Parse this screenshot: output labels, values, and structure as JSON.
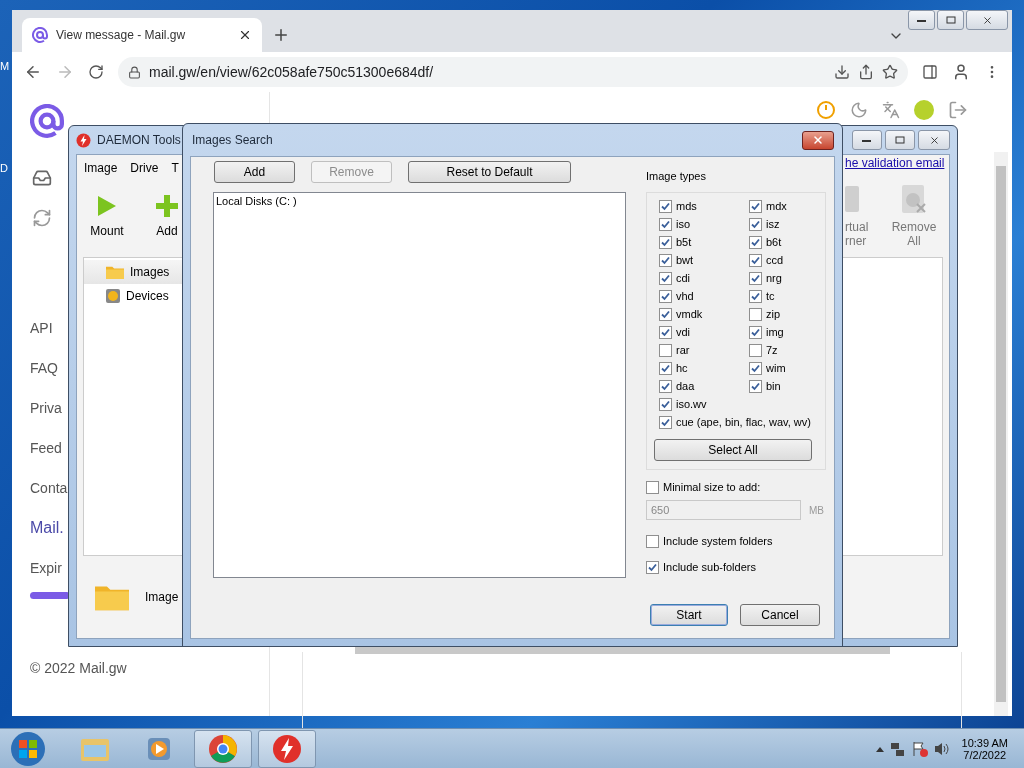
{
  "desktop": {
    "icon_labels": [
      "M",
      "D"
    ]
  },
  "browser": {
    "tab_title": "View message - Mail.gw",
    "url": "mail.gw/en/view/62c058afe750c51300e684df/"
  },
  "page": {
    "nav": [
      "API",
      "FAQ",
      "Priva",
      "Feed",
      "Conta"
    ],
    "brand": "Mail.",
    "expiry_label": "Expir",
    "validation_link": "he validation email",
    "footer": "© 2022 Mail.gw"
  },
  "daemon": {
    "title": "DAEMON Tools",
    "menu": [
      "Image",
      "Drive",
      "T"
    ],
    "toolbar": [
      {
        "label": "Mount",
        "kind": "mount"
      },
      {
        "label": "Add",
        "kind": "add"
      }
    ],
    "toolbar_right": [
      {
        "label": "rtual\nrner",
        "kind": "drive"
      },
      {
        "label": "Remove\nAll",
        "kind": "remove"
      }
    ],
    "tree": [
      {
        "label": "Images",
        "kind": "folder",
        "selected": true
      },
      {
        "label": "Devices",
        "kind": "device",
        "selected": false
      }
    ],
    "status_label": "Image"
  },
  "dialog": {
    "title": "Images Search",
    "buttons": [
      {
        "label": "Add",
        "disabled": false
      },
      {
        "label": "Remove",
        "disabled": true
      },
      {
        "label": "Reset to Default",
        "disabled": false
      }
    ],
    "locations": [
      "Local Disks (C: )"
    ],
    "image_types_title": "Image types",
    "types": [
      {
        "label": "mds",
        "checked": true,
        "kind": "short"
      },
      {
        "label": "mdx",
        "checked": true,
        "kind": "short"
      },
      {
        "label": "iso",
        "checked": true,
        "kind": "short"
      },
      {
        "label": "isz",
        "checked": true,
        "kind": "short"
      },
      {
        "label": "b5t",
        "checked": true,
        "kind": "short"
      },
      {
        "label": "b6t",
        "checked": true,
        "kind": "short"
      },
      {
        "label": "bwt",
        "checked": true,
        "kind": "short"
      },
      {
        "label": "ccd",
        "checked": true,
        "kind": "short"
      },
      {
        "label": "cdi",
        "checked": true,
        "kind": "short"
      },
      {
        "label": "nrg",
        "checked": true,
        "kind": "short"
      },
      {
        "label": "vhd",
        "checked": true,
        "kind": "short"
      },
      {
        "label": "tc",
        "checked": true,
        "kind": "short"
      },
      {
        "label": "vmdk",
        "checked": true,
        "kind": "short"
      },
      {
        "label": "zip",
        "checked": false,
        "kind": "short"
      },
      {
        "label": "vdi",
        "checked": true,
        "kind": "short"
      },
      {
        "label": "img",
        "checked": true,
        "kind": "short"
      },
      {
        "label": "rar",
        "checked": false,
        "kind": "short"
      },
      {
        "label": "7z",
        "checked": false,
        "kind": "short"
      },
      {
        "label": "hc",
        "checked": true,
        "kind": "short"
      },
      {
        "label": "wim",
        "checked": true,
        "kind": "short"
      },
      {
        "label": "daa",
        "checked": true,
        "kind": "short"
      },
      {
        "label": "bin",
        "checked": true,
        "kind": "short"
      },
      {
        "label": "iso.wv",
        "checked": true,
        "kind": "long"
      },
      {
        "label": "cue (ape, bin, flac, wav, wv)",
        "checked": true,
        "kind": "long"
      }
    ],
    "select_all": "Select All",
    "min_size": {
      "label": "Minimal size to add:",
      "checked": false,
      "value": "650",
      "unit": "MB"
    },
    "options": [
      {
        "label": "Include system folders",
        "checked": false
      },
      {
        "label": "Include sub-folders",
        "checked": true
      }
    ],
    "actions": [
      {
        "label": "Start",
        "default": true
      },
      {
        "label": "Cancel",
        "default": false
      }
    ]
  },
  "taskbar": {
    "apps": [
      {
        "kind": "explorer",
        "active": false
      },
      {
        "kind": "media",
        "active": false
      },
      {
        "kind": "chrome",
        "active": true
      },
      {
        "kind": "daemon",
        "active": true
      }
    ],
    "time": "10:39 AM",
    "date": "7/2/2022"
  }
}
